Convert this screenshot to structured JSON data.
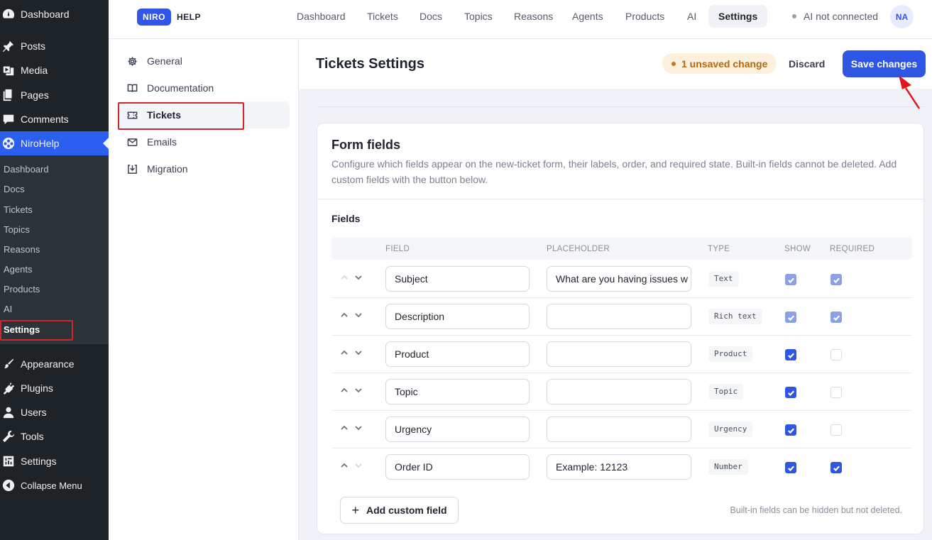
{
  "wp_menu": {
    "top_items": [
      {
        "label": "Dashboard",
        "icon": "dashboard-icon"
      },
      {
        "label": "Posts",
        "icon": "pin-icon"
      },
      {
        "label": "Media",
        "icon": "media-icon"
      },
      {
        "label": "Pages",
        "icon": "pages-icon"
      },
      {
        "label": "Comments",
        "icon": "comments-icon"
      },
      {
        "label": "NiroHelp",
        "icon": "nirohelp-icon"
      }
    ],
    "submenu": [
      "Dashboard",
      "Docs",
      "Tickets",
      "Topics",
      "Reasons",
      "Agents",
      "Products",
      "AI",
      "Settings"
    ],
    "bottom_items": [
      {
        "label": "Appearance",
        "icon": "brush-icon"
      },
      {
        "label": "Plugins",
        "icon": "plugin-icon"
      },
      {
        "label": "Users",
        "icon": "users-icon"
      },
      {
        "label": "Tools",
        "icon": "wrench-icon"
      },
      {
        "label": "Settings",
        "icon": "settings-icon"
      },
      {
        "label": "Collapse Menu",
        "icon": "collapse-icon"
      }
    ]
  },
  "topbar": {
    "logo_badge": "NIRO",
    "logo_text": "HELP",
    "nav": [
      "Dashboard",
      "Tickets",
      "Docs",
      "Topics",
      "Reasons",
      "Agents",
      "Products",
      "AI",
      "Settings"
    ],
    "active_nav": "Settings",
    "ai_status": "AI not connected",
    "avatar_initials": "NA"
  },
  "settings_nav": [
    {
      "label": "General",
      "icon": "gear-icon"
    },
    {
      "label": "Documentation",
      "icon": "book-icon"
    },
    {
      "label": "Tickets",
      "icon": "ticket-icon"
    },
    {
      "label": "Emails",
      "icon": "mail-icon"
    },
    {
      "label": "Migration",
      "icon": "import-icon"
    }
  ],
  "header": {
    "title": "Tickets Settings",
    "unsaved": "1 unsaved change",
    "discard": "Discard",
    "save": "Save changes"
  },
  "card": {
    "title": "Form fields",
    "description": "Configure which fields appear on the new-ticket form, their labels, order, and required state. Built-in fields cannot be deleted. Add custom fields with the button below.",
    "fields_label": "Fields",
    "columns": [
      "FIELD",
      "PLACEHOLDER",
      "TYPE",
      "SHOW",
      "REQUIRED"
    ],
    "rows": [
      {
        "label": "Subject",
        "placeholder": "What are you having issues w",
        "type": "Text",
        "show": "disabled-checked",
        "required": "disabled-checked"
      },
      {
        "label": "Description",
        "placeholder": "",
        "type": "Rich text",
        "show": "disabled-checked",
        "required": "disabled-checked"
      },
      {
        "label": "Product",
        "placeholder": "",
        "type": "Product",
        "show": "checked",
        "required": "unchecked"
      },
      {
        "label": "Topic",
        "placeholder": "",
        "type": "Topic",
        "show": "checked",
        "required": "unchecked"
      },
      {
        "label": "Urgency",
        "placeholder": "",
        "type": "Urgency",
        "show": "checked",
        "required": "unchecked"
      },
      {
        "label": "Order ID",
        "placeholder": "Example: 12123",
        "type": "Number",
        "show": "checked",
        "required": "checked"
      }
    ],
    "add_button": "Add custom field",
    "footnote": "Built-in fields can be hidden but not deleted."
  },
  "colors": {
    "accent": "#2e55e4",
    "wp_sidebar": "#1d2327",
    "annotation_red": "#d6242a"
  }
}
